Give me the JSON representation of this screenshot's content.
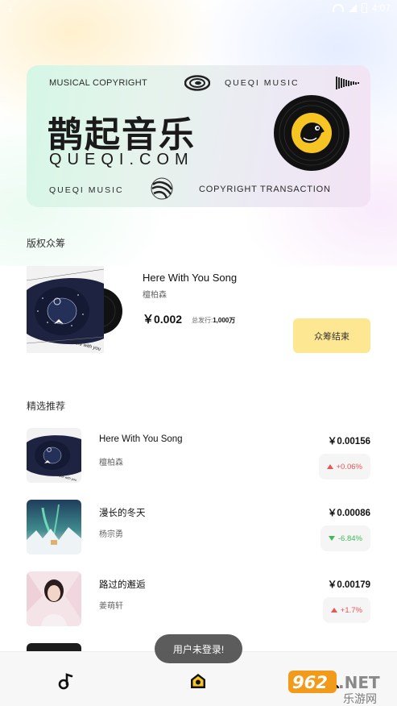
{
  "status_bar": {
    "time": "4:07"
  },
  "banner": {
    "top_left": "MUSICAL COPYRIGHT",
    "top_mid": "QUEQI MUSIC",
    "brand_cn": "鹊起音乐",
    "brand_en": "QUEQI.COM",
    "bottom_left": "QUEQI MUSIC",
    "bottom_right": "COPYRIGHT TRANSACTION"
  },
  "crowdfunding": {
    "section_title": "版权众筹",
    "song_title": "Here With You Song",
    "artist": "檀柏森",
    "price": "￥0.002",
    "issue_label": "总发行:",
    "issue_value": "1,000万",
    "button_label": "众筹结束"
  },
  "featured": {
    "section_title": "精选推荐",
    "items": [
      {
        "title": "Here With You Song",
        "artist": "檀柏森",
        "price": "￥0.00156",
        "change": "+0.06%",
        "trend": "up"
      },
      {
        "title": "漫长的冬天",
        "artist": "杨宗勇",
        "price": "￥0.00086",
        "change": "-6.84%",
        "trend": "down"
      },
      {
        "title": "路过的邂逅",
        "artist": "姜萌轩",
        "price": "￥0.00179",
        "change": "+1.7%",
        "trend": "up"
      },
      {
        "title": "",
        "artist": "",
        "price": "",
        "change": "",
        "trend": "up"
      }
    ]
  },
  "toast": "用户未登录!",
  "bottom_nav": {
    "items": [
      "music-note-icon",
      "home-icon",
      "profile-icon"
    ]
  },
  "watermark": {
    "text_top": "962.NET",
    "text_bottom": "乐游网"
  },
  "colors": {
    "accent_yellow": "#fde792",
    "up": "#e55656",
    "down": "#3dbb5a"
  }
}
